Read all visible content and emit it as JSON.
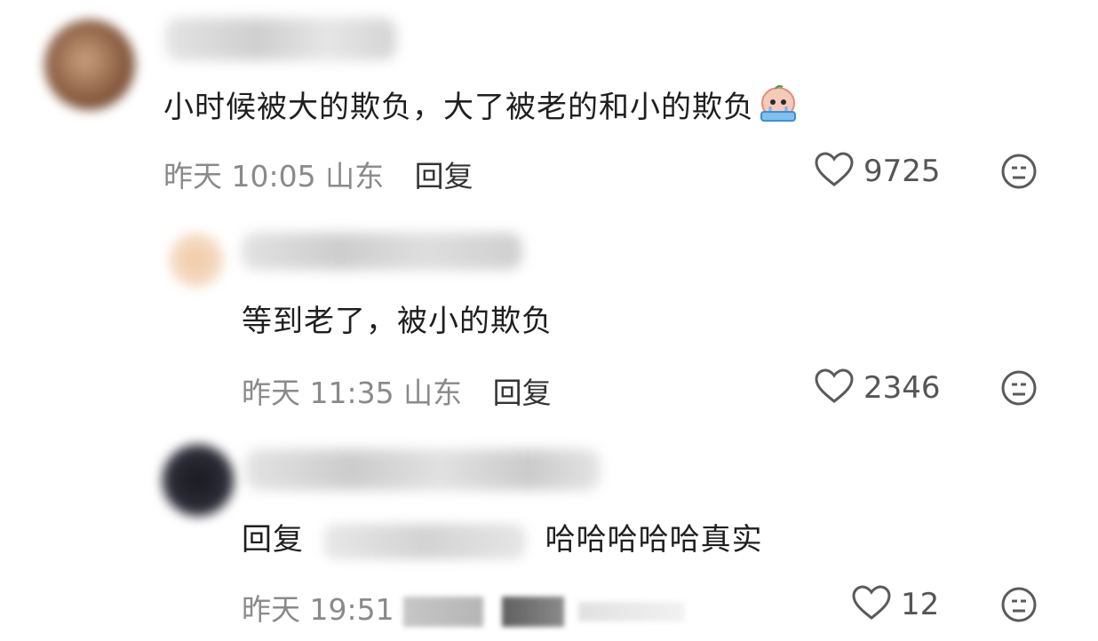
{
  "comments": [
    {
      "text": "小时候被大的欺负，大了被老的和小的欺负",
      "time": "昨天 10:05",
      "location": "山东",
      "reply_label": "回复",
      "likes": "9725"
    },
    {
      "text": "等到老了，被小的欺负",
      "time": "昨天 11:35",
      "location": "山东",
      "reply_label": "回复",
      "likes": "2346"
    },
    {
      "reply_prefix": "回复",
      "text": "哈哈哈哈哈真实",
      "time": "昨天 19:51",
      "likes": "12"
    }
  ],
  "icons": {
    "like": "heart-outline-icon",
    "react": "neutral-face-icon",
    "sticker": "crying-peach-sticker"
  },
  "colors": {
    "meta_text": "#8a8a8a",
    "body_text": "#1f1f1f",
    "icon_stroke": "#5a5a5a"
  }
}
